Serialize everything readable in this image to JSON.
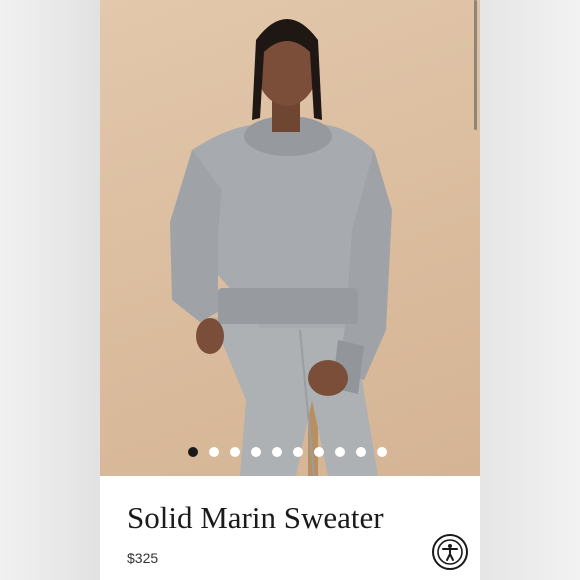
{
  "product": {
    "title": "Solid Marin Sweater",
    "price": "$325"
  },
  "carousel": {
    "dot_count": 10,
    "active_index": 0
  },
  "icons": {
    "accessibility": "accessibility-icon"
  },
  "colors": {
    "backdrop": "#d9bb9d",
    "sweater": "#a7abb0",
    "trousers": "#aeb1b4",
    "active_dot": "#1a1a1a",
    "inactive_dot": "#ffffff"
  }
}
